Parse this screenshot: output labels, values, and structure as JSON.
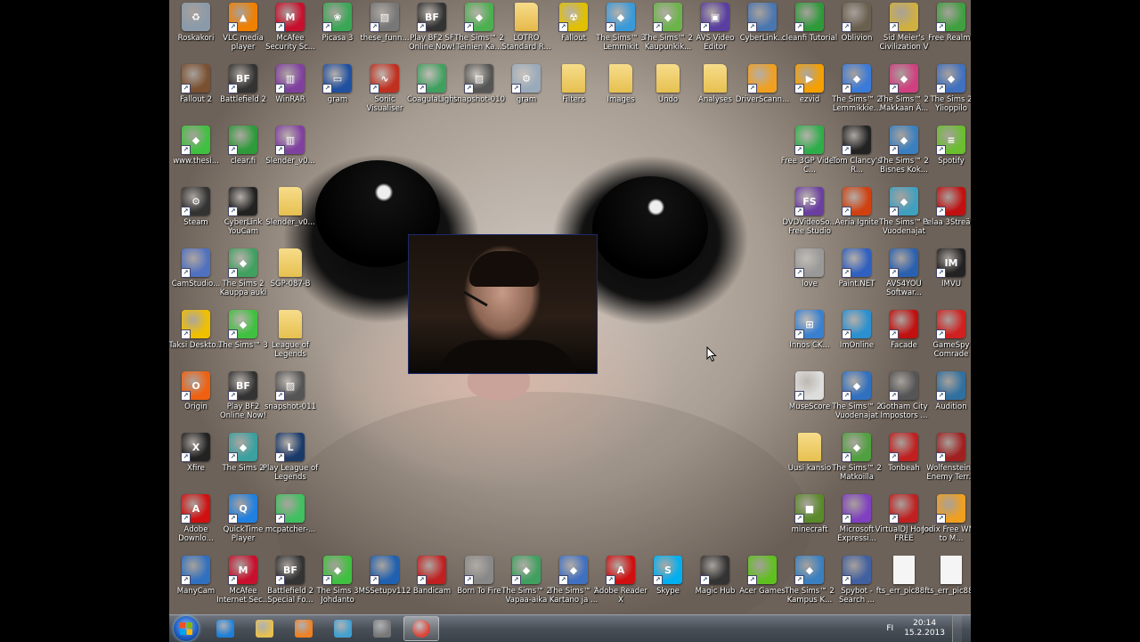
{
  "desktop": {
    "icons": [
      {
        "label": "Roskakori",
        "icon": "recycle-bin-icon",
        "color": "#8a9aaa"
      },
      {
        "label": "VLC media player",
        "icon": "vlc-icon",
        "color": "#f08000"
      },
      {
        "label": "McAfee Security Sc...",
        "icon": "mcafee-icon",
        "color": "#c8102e"
      },
      {
        "label": "Picasa 3",
        "icon": "picasa-icon",
        "color": "#3aa757"
      },
      {
        "label": "these_funn...",
        "icon": "image-file-icon",
        "color": "#777"
      },
      {
        "label": "Play BF2 SF Online Now!",
        "icon": "battlefield-icon",
        "color": "#333"
      },
      {
        "label": "The Sims™ 2 Teinien Ka...",
        "icon": "sims-icon",
        "color": "#4caf50"
      },
      {
        "label": "LOTRO Standard R...",
        "icon": "folder-zip-icon",
        "color": "#e6b84a"
      },
      {
        "label": "Fallout",
        "icon": "fallout-icon",
        "color": "#e0c000"
      },
      {
        "label": "The Sims™ 3 Lemmikit",
        "icon": "sims3-icon",
        "color": "#3a9ad9"
      },
      {
        "label": "The Sims™ 2 Kaupunkik...",
        "icon": "sims-icon",
        "color": "#6bb34a"
      },
      {
        "label": "AVS Video Editor",
        "icon": "film-icon",
        "color": "#5a3fa0"
      },
      {
        "label": "CyberLink...",
        "icon": "cyberlink-icon",
        "color": "#4a76b0"
      },
      {
        "label": "cleanfi Tutorial",
        "icon": "cleanfi-icon",
        "color": "#2e9a3a"
      },
      {
        "label": "Oblivion",
        "icon": "oblivion-icon",
        "color": "#6a6050"
      },
      {
        "label": "Sid Meier's Civilization V",
        "icon": "civ-icon",
        "color": "#d0b040"
      },
      {
        "label": "Free Realms",
        "icon": "free-realms-icon",
        "color": "#40a040"
      },
      {
        "label": "Fallout 2",
        "icon": "fallout2-icon",
        "color": "#7a5030"
      },
      {
        "label": "Battlefield 2",
        "icon": "battlefield-icon",
        "color": "#333"
      },
      {
        "label": "WinRAR",
        "icon": "winrar-icon",
        "color": "#8040a0"
      },
      {
        "label": "gram",
        "icon": "monitor-icon",
        "color": "#2050a0"
      },
      {
        "label": "Sonic Visualiser",
        "icon": "waveform-icon",
        "color": "#c03020"
      },
      {
        "label": "CoagulaLight",
        "icon": "coagula-icon",
        "color": "#40a060"
      },
      {
        "label": "snapshot-010",
        "icon": "image-file-icon",
        "color": "#555"
      },
      {
        "label": "gram",
        "icon": "gear-file-icon",
        "color": "#9ab"
      },
      {
        "label": "Filters",
        "icon": "folder-icon",
        "color": "#e6c050"
      },
      {
        "label": "Images",
        "icon": "folder-icon",
        "color": "#e6c050"
      },
      {
        "label": "Undo",
        "icon": "folder-icon",
        "color": "#e6c050"
      },
      {
        "label": "Analyses",
        "icon": "folder-icon",
        "color": "#e6c050"
      },
      {
        "label": "DriverScann...",
        "icon": "driver-icon",
        "color": "#f0a020"
      },
      {
        "label": "ezvid",
        "icon": "ezvid-icon",
        "color": "#f5a000"
      },
      {
        "label": "The Sims™ 2 Lemmikkie...",
        "icon": "sims-icon",
        "color": "#3a7ad9"
      },
      {
        "label": "The Sims™ 2 Makkaan Ä...",
        "icon": "sims-icon",
        "color": "#d04080"
      },
      {
        "label": "The Sims 2 Ylioppilo",
        "icon": "sims-icon",
        "color": "#4070c0"
      },
      {
        "label": "www.thesi...",
        "icon": "sims-plumbob-icon",
        "color": "#40c040"
      },
      {
        "label": "clear.fi",
        "icon": "clearfi-icon",
        "color": "#2e9a3a"
      },
      {
        "label": "Slender_v0...",
        "icon": "winrar-icon",
        "color": "#8040a0"
      },
      {
        "label": "Free 3GP Video C...",
        "icon": "3gp-icon",
        "color": "#2eae4a"
      },
      {
        "label": "Tom Clancy's R...",
        "icon": "rainbow-icon",
        "color": "#222"
      },
      {
        "label": "The Sims™ 2 Bisnes Kok...",
        "icon": "sims-icon",
        "color": "#3a80c0"
      },
      {
        "label": "Spotify",
        "icon": "spotify-icon",
        "color": "#6abe30"
      },
      {
        "label": "Steam",
        "icon": "steam-icon",
        "color": "#333"
      },
      {
        "label": "CyberLink YouCam",
        "icon": "youcam-icon",
        "color": "#222"
      },
      {
        "label": "Slender_v0...",
        "icon": "folder-icon",
        "color": "#e6c050"
      },
      {
        "label": "DVDVideoSo... Free Studio",
        "icon": "fs-icon",
        "color": "#6a3fa0"
      },
      {
        "label": "Aeria Ignite",
        "icon": "aeria-icon",
        "color": "#d04010"
      },
      {
        "label": "The Sims™ 2 Vuodenajat",
        "icon": "sims-icon",
        "color": "#40a0c0"
      },
      {
        "label": "Pelaa 3Streäna",
        "icon": "pelaa-icon",
        "color": "#c01010"
      },
      {
        "label": "CamStudio...",
        "icon": "camstudio-icon",
        "color": "#5070c0"
      },
      {
        "label": "The Sims 2 Kauppa auki",
        "icon": "sims-icon",
        "color": "#40a060"
      },
      {
        "label": "SGP-087-B",
        "icon": "folder-icon",
        "color": "#e6c050"
      },
      {
        "label": "love",
        "icon": "love-icon",
        "color": "#999"
      },
      {
        "label": "Paint.NET",
        "icon": "paintnet-icon",
        "color": "#3060c0"
      },
      {
        "label": "AVS4YOU Softwar...",
        "icon": "avs-icon",
        "color": "#2a60b0"
      },
      {
        "label": "IMVU",
        "icon": "imvu-icon",
        "color": "#222"
      },
      {
        "label": "Taksi Deskto...",
        "icon": "taksi-icon",
        "color": "#f0c000"
      },
      {
        "label": "The Sims™ 3",
        "icon": "sims3-icon",
        "color": "#40c040"
      },
      {
        "label": "League of Legends",
        "icon": "folder-icon",
        "color": "#e6c050"
      },
      {
        "label": "Innos CK...",
        "icon": "windows-icon",
        "color": "#3a80d0"
      },
      {
        "label": "ImOnline",
        "icon": "imonline-icon",
        "color": "#2a90d0"
      },
      {
        "label": "Facade",
        "icon": "facade-icon",
        "color": "#c01010"
      },
      {
        "label": "GameSpy Comrade",
        "icon": "gamespy-icon",
        "color": "#d02020"
      },
      {
        "label": "Origin",
        "icon": "origin-icon",
        "color": "#f06010"
      },
      {
        "label": "Play BF2 Online Now!",
        "icon": "battlefield-icon",
        "color": "#333"
      },
      {
        "label": "snapshot-011",
        "icon": "image-file-icon",
        "color": "#555"
      },
      {
        "label": "MuseScore",
        "icon": "musescore-icon",
        "color": "#ddd"
      },
      {
        "label": "The Sims™ 2 Vuodenajat",
        "icon": "sims-icon",
        "color": "#3070c0"
      },
      {
        "label": "Gotham City Impostors ...",
        "icon": "gotham-icon",
        "color": "#555"
      },
      {
        "label": "Audition",
        "icon": "audition-icon",
        "color": "#3070a0"
      },
      {
        "label": "Xfire",
        "icon": "xfire-icon",
        "color": "#222"
      },
      {
        "label": "The Sims 2",
        "icon": "sims-icon",
        "color": "#3aa0a0"
      },
      {
        "label": "Play League of Legends",
        "icon": "lol-icon",
        "color": "#1a3a6a"
      },
      {
        "label": "Uusi kansio",
        "icon": "folder-icon",
        "color": "#e6c050"
      },
      {
        "label": "The Sims™ 2 Matkoilla",
        "icon": "sims-icon",
        "color": "#50a040"
      },
      {
        "label": "Tonbeah",
        "icon": "tonbeah-icon",
        "color": "#c02020"
      },
      {
        "label": "Wolfenstein - Enemy Terr...",
        "icon": "wolfenstein-icon",
        "color": "#a02020"
      },
      {
        "label": "Adobe Downlo...",
        "icon": "adobe-icon",
        "color": "#d01010"
      },
      {
        "label": "QuickTime Player",
        "icon": "quicktime-icon",
        "color": "#2080e0"
      },
      {
        "label": "mcpatcher-...",
        "icon": "mcpatcher-icon",
        "color": "#40c060"
      },
      {
        "label": "minecraft",
        "icon": "minecraft-icon",
        "color": "#5a8a2a"
      },
      {
        "label": "Microsoft Expressi...",
        "icon": "expression-icon",
        "color": "#8040c0"
      },
      {
        "label": "VirtualDJ Home FREE",
        "icon": "virtualdj-icon",
        "color": "#c02020"
      },
      {
        "label": "Jodix Free WMA to M...",
        "icon": "jodix-icon",
        "color": "#f0a020"
      },
      {
        "label": "ManyCam",
        "icon": "manycam-icon",
        "color": "#3070c0"
      },
      {
        "label": "McAfee Internet Sec...",
        "icon": "mcafee-icon",
        "color": "#c8102e"
      },
      {
        "label": "Battlefield 2 Special Fo...",
        "icon": "battlefield-icon",
        "color": "#333"
      },
      {
        "label": "The Sims 3 Johdanto",
        "icon": "sims3-icon",
        "color": "#40c040"
      },
      {
        "label": "MSSetupv112",
        "icon": "setup-icon",
        "color": "#2060b0"
      },
      {
        "label": "Bandicam",
        "icon": "bandicam-icon",
        "color": "#c02020"
      },
      {
        "label": "Born To Fire",
        "icon": "born-to-fire-icon",
        "color": "#888"
      },
      {
        "label": "The Sims™ 2 Vapaa-aika",
        "icon": "sims-icon",
        "color": "#40a060"
      },
      {
        "label": "The Sims™ 2 Kartano ja ...",
        "icon": "sims-icon",
        "color": "#4070c0"
      },
      {
        "label": "Adobe Reader X",
        "icon": "acrobat-icon",
        "color": "#d01010"
      },
      {
        "label": "Skype",
        "icon": "skype-icon",
        "color": "#00aff0"
      },
      {
        "label": "Magic Hub",
        "icon": "magichub-icon",
        "color": "#333"
      },
      {
        "label": "Acer Games",
        "icon": "acer-games-icon",
        "color": "#60c020"
      },
      {
        "label": "The Sims™ 2 Kampus K...",
        "icon": "sims-icon",
        "color": "#3a80c0"
      },
      {
        "label": "Spybot - Search ...",
        "icon": "spybot-icon",
        "color": "#4060a0"
      },
      {
        "label": "fts_err_pic88...",
        "icon": "text-file-icon",
        "color": "#eee"
      },
      {
        "label": "fts_err_pic888",
        "icon": "text-file-icon",
        "color": "#eee"
      }
    ]
  },
  "taskbar": {
    "buttons": [
      {
        "icon": "ie-icon",
        "color": "#1e7fd8"
      },
      {
        "icon": "explorer-folder-icon",
        "color": "#e6c050"
      },
      {
        "icon": "media-player-icon",
        "color": "#f08020"
      },
      {
        "icon": "paint-icon",
        "color": "#40a0d0"
      },
      {
        "icon": "imvu-icon",
        "color": "#777"
      },
      {
        "icon": "chrome-icon",
        "color": "#db4437"
      }
    ],
    "language": "FI",
    "time": "20:14",
    "date": "15.2.2013"
  }
}
